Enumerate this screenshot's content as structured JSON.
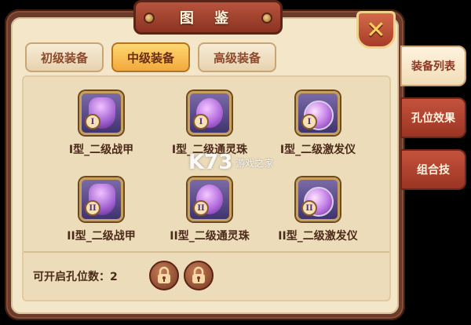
{
  "window": {
    "title": "图 鉴"
  },
  "tier_tabs": [
    {
      "label": "初级装备",
      "active": false
    },
    {
      "label": "中级装备",
      "active": true
    },
    {
      "label": "高级装备",
      "active": false
    }
  ],
  "side_tabs": [
    {
      "label": "装备列表",
      "active": true
    },
    {
      "label": "孔位效果",
      "active": false
    },
    {
      "label": "组合技",
      "active": false
    }
  ],
  "items": [
    {
      "label": "I型_二级战甲",
      "grade": "I",
      "icon": "armor-icon"
    },
    {
      "label": "I型_二级通灵珠",
      "grade": "I",
      "icon": "spirit-orb-icon"
    },
    {
      "label": "I型_二级激发仪",
      "grade": "I",
      "icon": "pendant-icon"
    },
    {
      "label": "II型_二级战甲",
      "grade": "II",
      "icon": "armor-icon"
    },
    {
      "label": "II型_二级通灵珠",
      "grade": "II",
      "icon": "spirit-orb-icon"
    },
    {
      "label": "II型_二级激发仪",
      "grade": "II",
      "icon": "pendant-icon"
    }
  ],
  "footer": {
    "slot_text": "可开启孔位数：2"
  },
  "watermark": {
    "logo": "K73",
    "text": "游戏之家"
  },
  "colors": {
    "accent": "#f2a93b",
    "frame": "#6b3a2a",
    "panel": "#f3e6c9"
  }
}
